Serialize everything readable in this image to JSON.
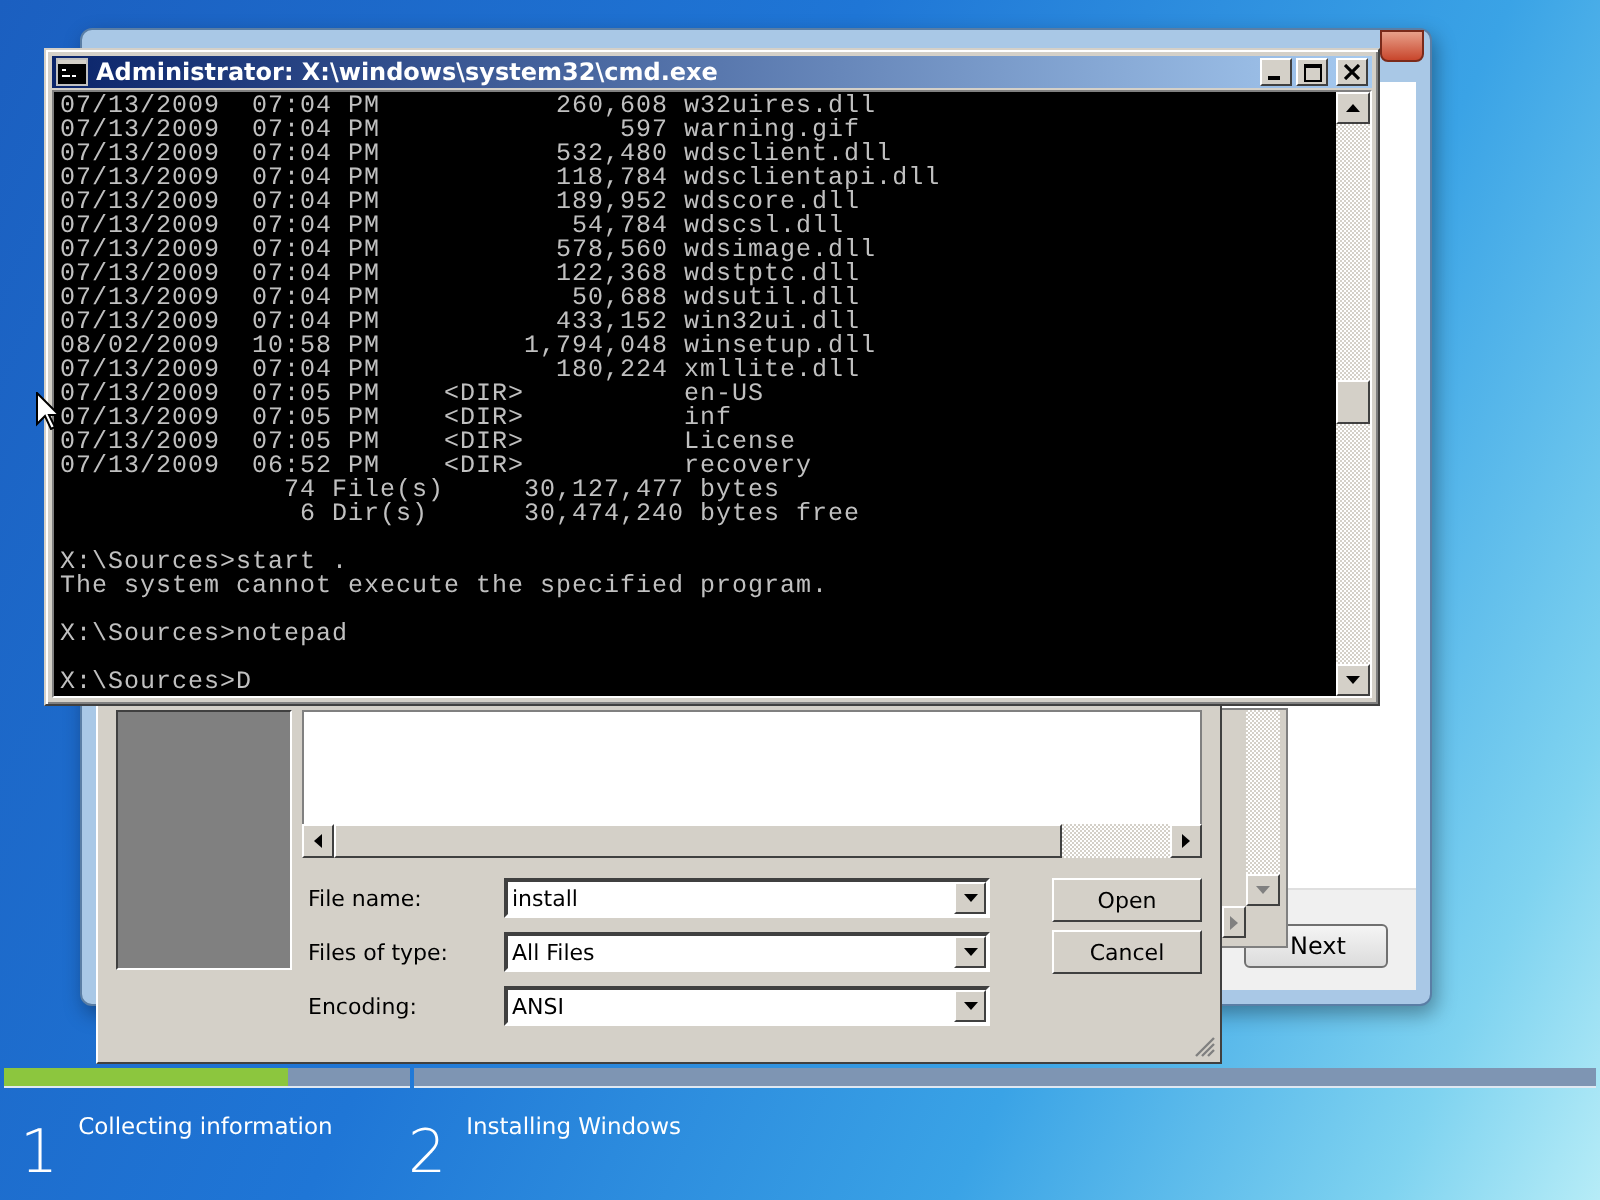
{
  "cmd_window": {
    "title": "Administrator: X:\\windows\\system32\\cmd.exe",
    "output_blocks": [
      [
        "07/13/2009  07:04 PM           260,608 w32uires.dll",
        "07/13/2009  07:04 PM               597 warning.gif",
        "07/13/2009  07:04 PM           532,480 wdsclient.dll",
        "07/13/2009  07:04 PM           118,784 wdsclientapi.dll",
        "07/13/2009  07:04 PM           189,952 wdscore.dll",
        "07/13/2009  07:04 PM            54,784 wdscsl.dll",
        "07/13/2009  07:04 PM           578,560 wdsimage.dll",
        "07/13/2009  07:04 PM           122,368 wdstptc.dll",
        "07/13/2009  07:04 PM            50,688 wdsutil.dll",
        "07/13/2009  07:04 PM           433,152 win32ui.dll",
        "08/02/2009  10:58 PM         1,794,048 winsetup.dll",
        "07/13/2009  07:04 PM           180,224 xmllite.dll",
        "07/13/2009  07:05 PM    <DIR>          en-US",
        "07/13/2009  07:05 PM    <DIR>          inf",
        "07/13/2009  07:05 PM    <DIR>          License",
        "07/13/2009  06:52 PM    <DIR>          recovery",
        "              74 File(s)     30,127,477 bytes",
        "               6 Dir(s)      30,474,240 bytes free"
      ],
      [
        "X:\\Sources>start .",
        "The system cannot execute the specified program."
      ],
      [
        "X:\\Sources>notepad"
      ],
      [
        "X:\\Sources>D"
      ]
    ]
  },
  "open_dialog": {
    "fields": [
      {
        "label": "File name:",
        "value": "install"
      },
      {
        "label": "Files of type:",
        "value": "All Files"
      },
      {
        "label": "Encoding:",
        "value": "ANSI"
      }
    ],
    "buttons": [
      "Open",
      "Cancel"
    ]
  },
  "setup_window": {
    "button": "Next"
  },
  "steps": [
    {
      "number": "1",
      "label": "Collecting information",
      "level": 0.7
    },
    {
      "number": "2",
      "label": "Installing Windows"
    }
  ]
}
